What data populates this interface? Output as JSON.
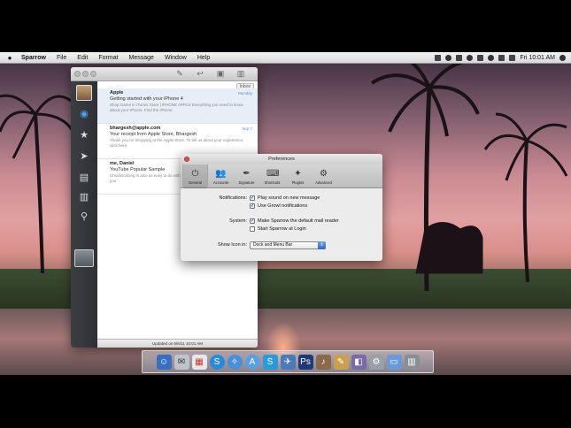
{
  "menubar": {
    "apple": "",
    "items": [
      "Sparrow",
      "File",
      "Edit",
      "Format",
      "Message",
      "Window",
      "Help"
    ],
    "clock": "Fri 10:01 AM"
  },
  "sparrow": {
    "filter": "Inbox",
    "messages": [
      {
        "from": "Apple",
        "subject": "Getting started with your iPhone 4",
        "preview": "Shop Game in iTunes Store | iPHONE APPLE Everything you need to know about your iPhone. Find the iPhone",
        "date": "Monday"
      },
      {
        "from": "bhargesh@apple.com",
        "subject": "Your receipt from Apple Store, Bhargesh",
        "preview": "Thank you for shopping at the Apple Store. To tell us about your experience, click here",
        "date": "Sep 7"
      },
      {
        "from": "me, Daniel",
        "subject": "YouTube Popular Sample",
        "preview": "Unsubscribing is also as easy to do with the previous improvements that provide you",
        "date": ""
      }
    ],
    "status": "Updated on 6/6/11 10:01 AM"
  },
  "preferences": {
    "title": "Preferences",
    "tabs": [
      {
        "label": "General",
        "icon": "switch-icon"
      },
      {
        "label": "Accounts",
        "icon": "people-icon"
      },
      {
        "label": "Signature",
        "icon": "pen-icon"
      },
      {
        "label": "Shortcuts",
        "icon": "keyboard-icon"
      },
      {
        "label": "Plugins",
        "icon": "puzzle-icon"
      },
      {
        "label": "Advanced",
        "icon": "gear-icon"
      }
    ],
    "notifications_label": "Notifications:",
    "play_sound": "Play sound on new message",
    "use_growl": "Use Growl notifications",
    "system_label": "System:",
    "default_reader": "Make Sparrow the default mail reader",
    "start_login": "Start Sparrow at Login",
    "show_icon_label": "Show Icon in:",
    "show_icon_value": "Dock and Menu Bar"
  }
}
